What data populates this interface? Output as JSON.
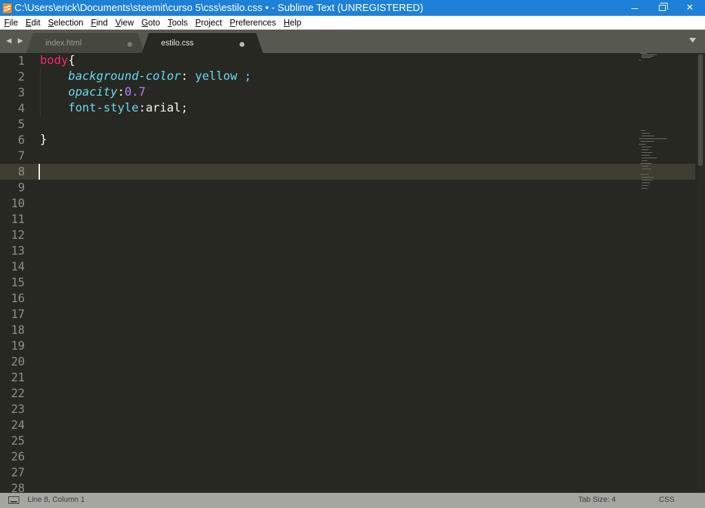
{
  "window": {
    "title": "C:\\Users\\erick\\Documents\\steemit\\curso 5\\css\\estilo.css • - Sublime Text (UNREGISTERED)",
    "icon": "sublime-text-icon",
    "colors": {
      "titlebar": "#1e80d6",
      "editor_bg": "#272822",
      "tag": "#f92672",
      "property": "#66d9ef",
      "number": "#ae81ff"
    }
  },
  "menu": [
    "File",
    "Edit",
    "Selection",
    "Find",
    "View",
    "Goto",
    "Tools",
    "Project",
    "Preferences",
    "Help"
  ],
  "tabs": [
    {
      "label": "index.html",
      "active": false,
      "modified": true
    },
    {
      "label": "estilo.css",
      "active": true,
      "modified": true
    }
  ],
  "editor": {
    "current_line": 8,
    "line_numbers": [
      "1",
      "2",
      "3",
      "4",
      "5",
      "6",
      "7",
      "8",
      "9",
      "10",
      "11",
      "12",
      "13",
      "14",
      "15",
      "16",
      "17",
      "18",
      "19",
      "20",
      "21",
      "22",
      "23",
      "24",
      "25",
      "26",
      "27",
      "28"
    ],
    "code": {
      "l1": {
        "selector": "body",
        "brace": "{"
      },
      "l2": {
        "property": "background-color",
        "colon": ":",
        "value": " yellow ;"
      },
      "l3": {
        "property": "opacity",
        "colon": ":",
        "value": "0.7"
      },
      "l4": {
        "property": "font-style",
        "colon": ":",
        "value": "arial;"
      },
      "l6": {
        "brace": "}"
      }
    }
  },
  "status": {
    "position": "Line 8, Column 1",
    "tab_size": "Tab Size: 4",
    "syntax": "CSS"
  }
}
